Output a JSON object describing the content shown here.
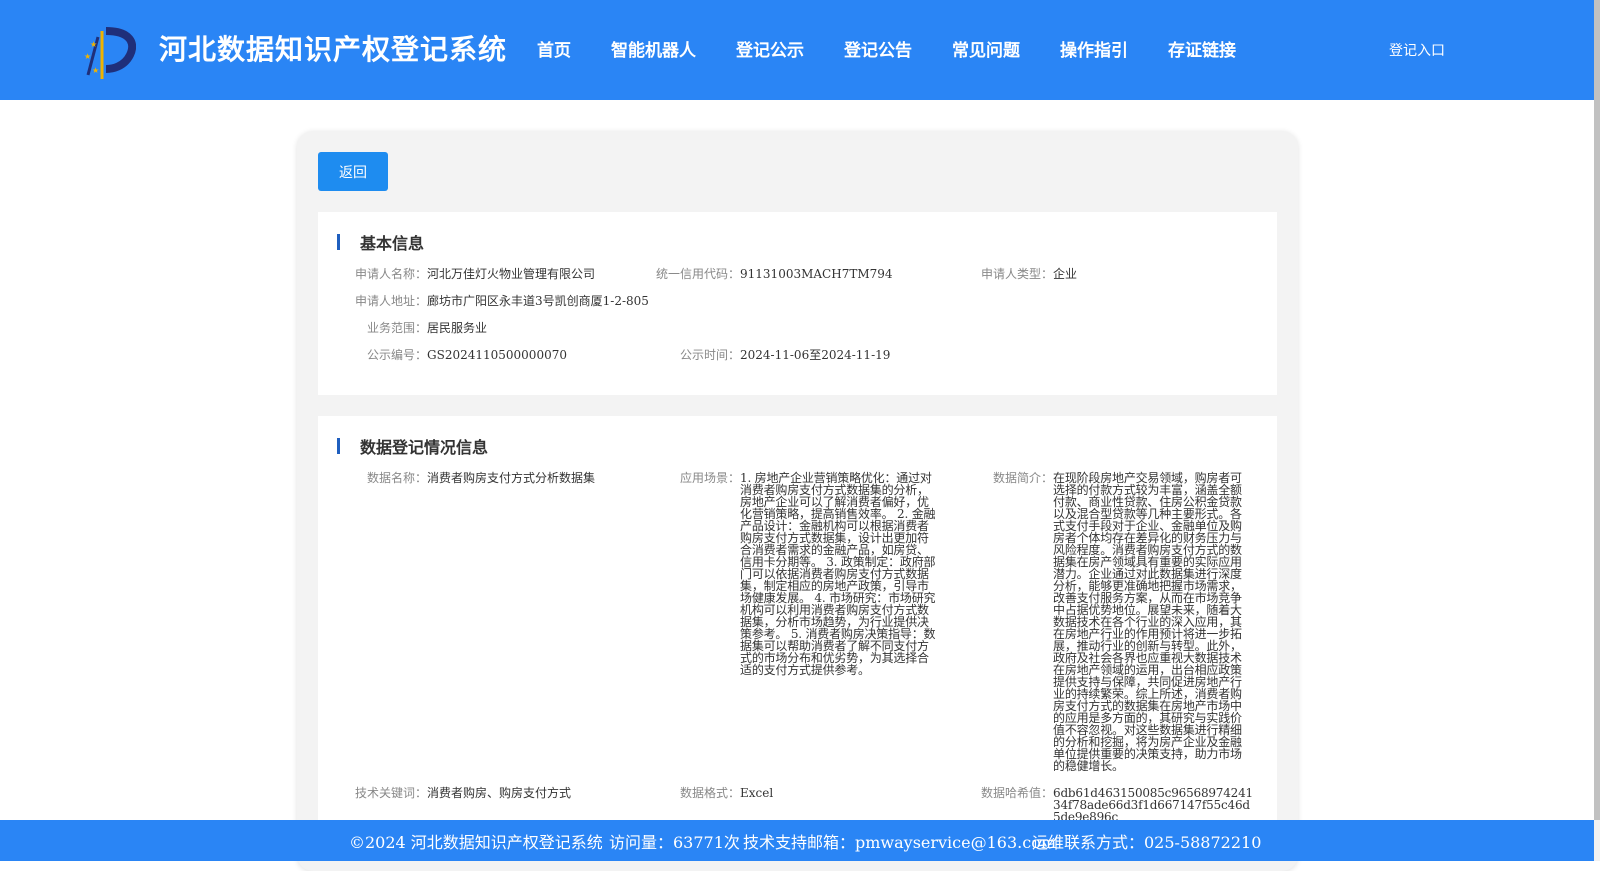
{
  "header": {
    "title": "河北数据知识产权登记系统",
    "nav": [
      "首页",
      "智能机器人",
      "登记公示",
      "登记公告",
      "常见问题",
      "操作指引",
      "存证链接"
    ],
    "login": "登记入口"
  },
  "back_label": "返回",
  "basic": {
    "title": "基本信息",
    "applicant_name_label": "申请人名称：",
    "applicant_name": "河北万佳灯火物业管理有限公司",
    "credit_code_label": "统一信用代码：",
    "credit_code": "91131003MACH7TM794",
    "applicant_type_label": "申请人类型：",
    "applicant_type": "企业",
    "address_label": "申请人地址：",
    "address": "廊坊市广阳区永丰道3号凯创商厦1-2-805",
    "scope_label": "业务范围：",
    "scope": "居民服务业",
    "notice_no_label": "公示编号：",
    "notice_no": "GS2024110500000070",
    "notice_time_label": "公示时间：",
    "notice_time": "2024-11-06至2024-11-19"
  },
  "registration": {
    "title": "数据登记情况信息",
    "data_name_label": "数据名称：",
    "data_name": "消费者购房支付方式分析数据集",
    "scenario_label": "应用场景：",
    "scenario": "1. 房地产企业营销策略优化：通过对消费者购房支付方式数据集的分析，房地产企业可以了解消费者偏好，优化营销策略，提高销售效率。 2. 金融产品设计：金融机构可以根据消费者购房支付方式数据集，设计出更加符合消费者需求的金融产品，如房贷、信用卡分期等。 3. 政策制定：政府部门可以依据消费者购房支付方式数据集，制定相应的房地产政策，引导市场健康发展。 4. 市场研究：市场研究机构可以利用消费者购房支付方式数据集，分析市场趋势，为行业提供决策参考。 5. 消费者购房决策指导：数据集可以帮助消费者了解不同支付方式的市场分布和优劣势，为其选择合适的支付方式提供参考。",
    "intro_label": "数据简介：",
    "intro": "在现阶段房地产交易领域，购房者可选择的付款方式较为丰富，涵盖全额付款、商业性贷款、住房公积金贷款以及混合型贷款等几种主要形式。各式支付手段对于企业、金融单位及购房者个体均存在差异化的财务压力与风险程度。消费者购房支付方式的数据集在房产领域具有重要的实际应用潜力。企业通过对此数据集进行深度分析，能够更准确地把握市场需求，改善支付服务方案，从而在市场竞争中占据优势地位。展望未来，随着大数据技术在各个行业的深入应用，其在房地产行业的作用预计将进一步拓展，推动行业的创新与转型。此外，政府及社会各界也应重视大数据技术在房地产领域的运用，出台相应政策提供支持与保障，共同促进房地产行业的持续繁荣。综上所述，消费者购房支付方式的数据集在房地产市场中的应用是多方面的，其研究与实践价值不容忽视。对这些数据集进行精细的分析和挖掘，将为房产企业及金融单位提供重要的决策支持，助力市场的稳健增长。",
    "keywords_label": "技术关键词：",
    "keywords": "消费者购房、购房支付方式",
    "format_label": "数据格式：",
    "format": "Excel",
    "hash_label": "数据哈希值：",
    "hash": "6db61d463150085c9656897424134f78ade66d3f1d667147f55c46d5de9e896c"
  },
  "footer": {
    "copyright": "©2024 河北数据知识产权登记系统",
    "visits": "访问量：63771次",
    "email": "技术支持邮箱：pmwayservice@163.com",
    "phone": "运维联系方式：025-58872210"
  }
}
